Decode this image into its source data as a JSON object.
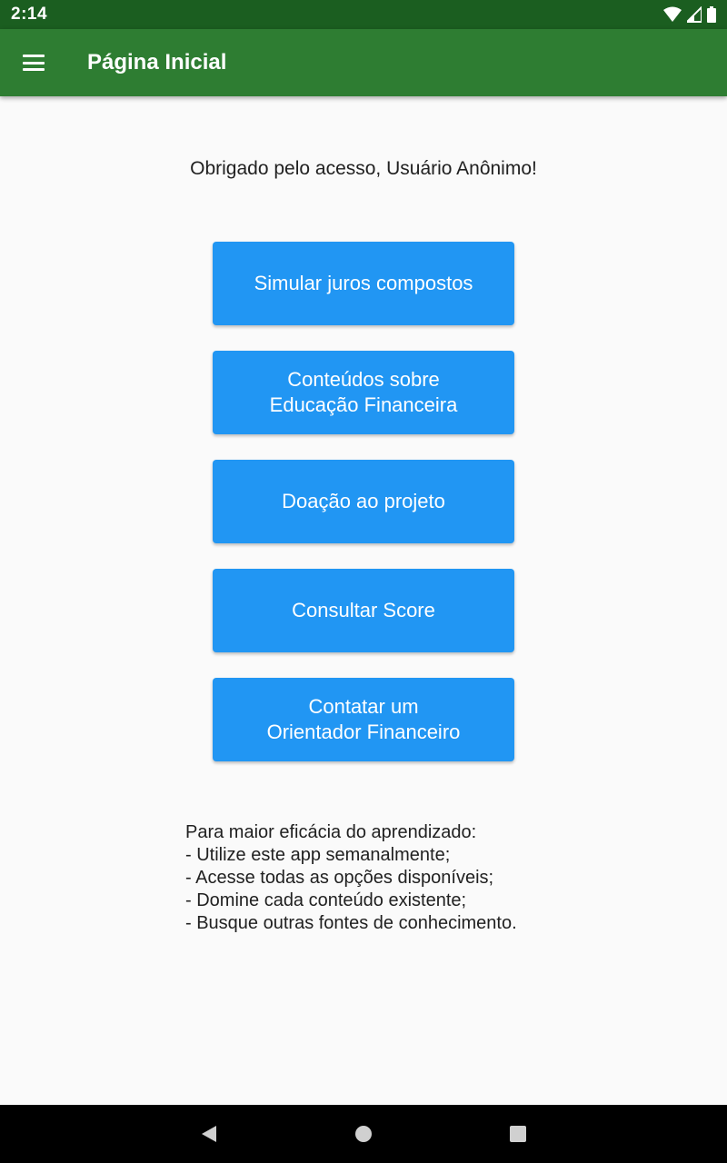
{
  "status_bar": {
    "time": "2:14",
    "icons": [
      "wifi-icon",
      "signal-icon",
      "battery-icon"
    ]
  },
  "app_bar": {
    "menu_icon": "menu-icon",
    "title": "Página Inicial",
    "color": "#2e7d32"
  },
  "main": {
    "greeting": "Obrigado pelo acesso, Usuário Anônimo!",
    "buttons": [
      {
        "label": "Simular juros compostos"
      },
      {
        "label": "Conteúdos sobre\nEducação Financeira"
      },
      {
        "label": "Doação ao projeto"
      },
      {
        "label": "Consultar Score"
      },
      {
        "label": "Contatar um\nOrientador Financeiro"
      }
    ],
    "button_color": "#2196f3",
    "tips": [
      "Para maior eficácia do aprendizado:",
      "- Utilize este app semanalmente;",
      "- Acesse todas as opções disponíveis;",
      "- Domine cada conteúdo existente;",
      "- Busque outras fontes de conhecimento."
    ]
  },
  "nav_bar": {
    "icons": [
      "back-icon",
      "home-icon",
      "recents-icon"
    ]
  }
}
